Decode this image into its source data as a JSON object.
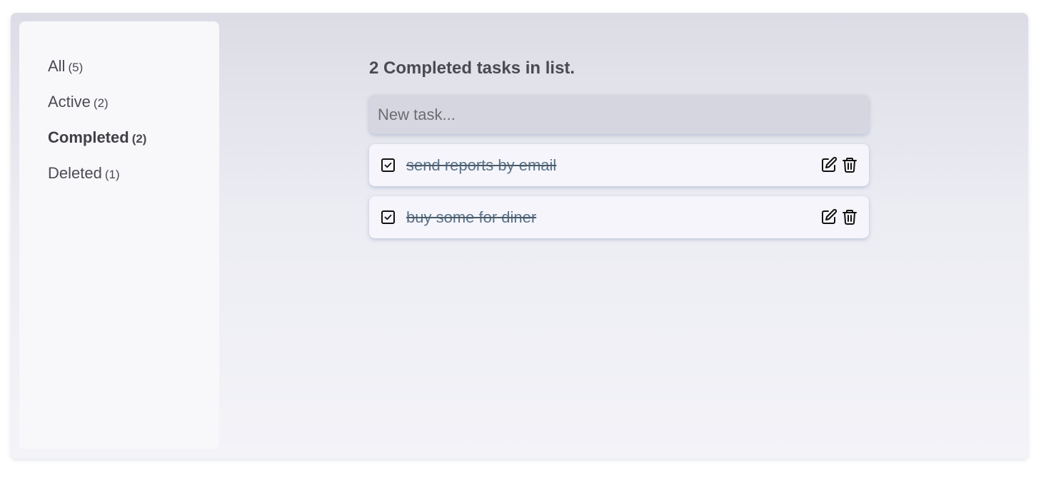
{
  "sidebar": {
    "filters": [
      {
        "label": "All",
        "count": "(5)"
      },
      {
        "label": "Active",
        "count": "(2)"
      },
      {
        "label": "Completed",
        "count": "(2)"
      },
      {
        "label": "Deleted",
        "count": "(1)"
      }
    ],
    "selected": "Completed"
  },
  "main": {
    "heading": "2 Completed tasks in list.",
    "new_task": {
      "placeholder": "New task...",
      "value": ""
    },
    "tasks": [
      {
        "text": "send reports by email",
        "completed": true,
        "checkbox_icon": "checked-box-icon",
        "edit_icon": "edit-icon",
        "delete_icon": "trash-icon"
      },
      {
        "text": "buy some for diner",
        "completed": true,
        "checkbox_icon": "checked-box-icon",
        "edit_icon": "edit-icon",
        "delete_icon": "trash-icon"
      }
    ]
  },
  "colors": {
    "completed_text": "#5a7289",
    "sidebar_bg": "#f8f8fb",
    "input_bg": "#d6d6e0",
    "task_bg": "#f5f5fb"
  }
}
